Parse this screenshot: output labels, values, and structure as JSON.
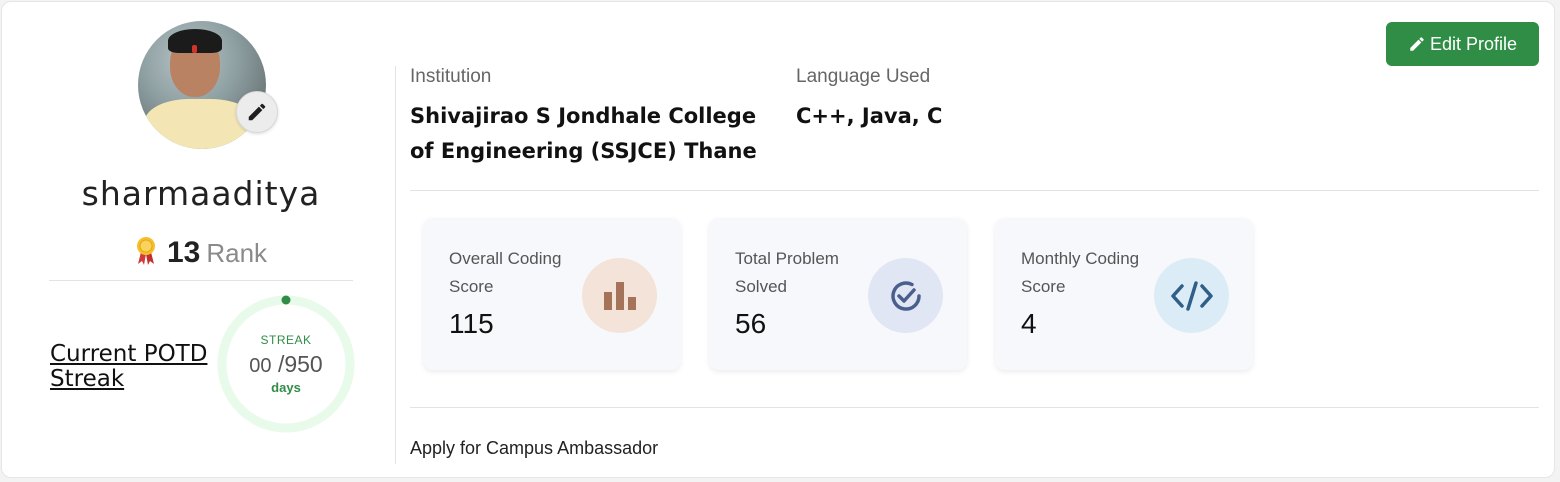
{
  "profile": {
    "username": "sharmaaditya",
    "rank_value": "13",
    "rank_label": "Rank",
    "potd_label": "Current POTD Streak",
    "streak": {
      "title": "STREAK",
      "current": "00",
      "total": "/950",
      "unit": "days",
      "progress_fraction": 0.0
    }
  },
  "header": {
    "edit_profile_label": "Edit Profile"
  },
  "info": {
    "institution_label": "Institution",
    "institution_value": "Shivajirao S Jondhale College of Engineering (SSJCE) Thane",
    "language_label": "Language Used",
    "language_value": "C++, Java, C"
  },
  "stats": [
    {
      "label": "Overall Coding Score",
      "value": "115",
      "icon": "bar-chart-icon",
      "color": "#a5735a",
      "bg": "#f4e3d9"
    },
    {
      "label": "Total Problem Solved",
      "value": "56",
      "icon": "check-circle-icon",
      "color": "#4a5f8c",
      "bg": "#e1e6f4"
    },
    {
      "label": "Monthly Coding Score",
      "value": "4",
      "icon": "code-icon",
      "color": "#2f5f86",
      "bg": "#dcecf7"
    }
  ],
  "footer": {
    "ambassador_label": "Apply for Campus Ambassador"
  },
  "colors": {
    "primary_green": "#2f8d46",
    "ring_track": "#e8fae9"
  }
}
